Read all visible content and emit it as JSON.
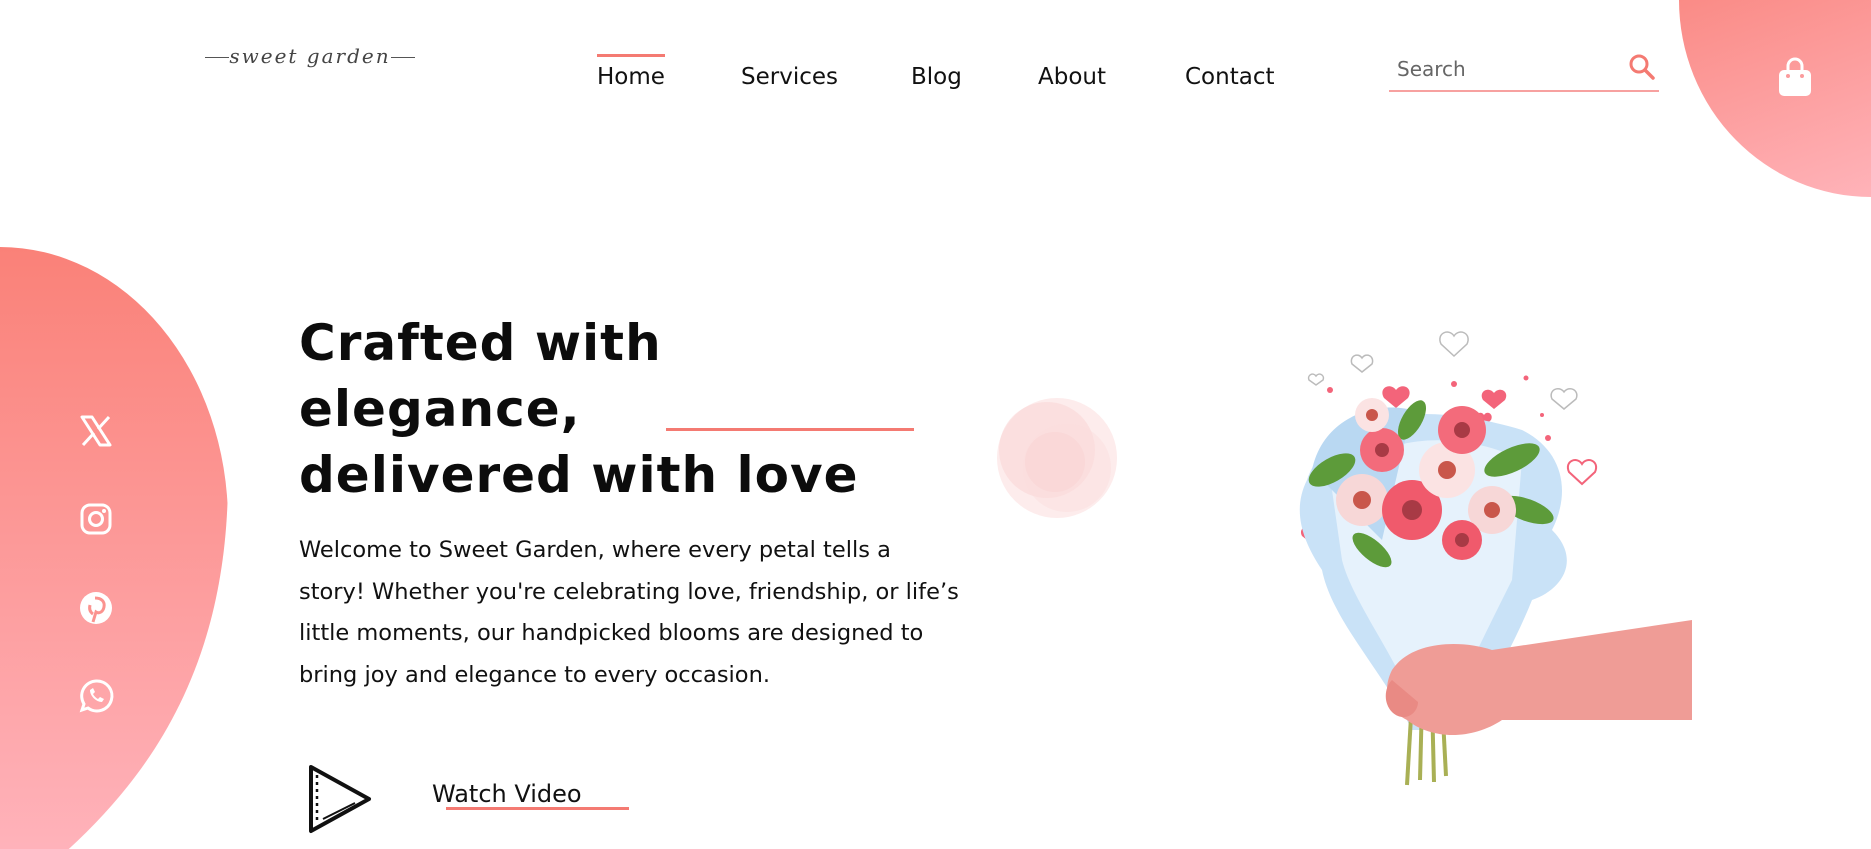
{
  "brand": {
    "logo_text": "sweet garden"
  },
  "nav": {
    "items": [
      {
        "label": "Home",
        "active": true
      },
      {
        "label": "Services",
        "active": false
      },
      {
        "label": "Blog",
        "active": false
      },
      {
        "label": "About",
        "active": false
      },
      {
        "label": "Contact",
        "active": false
      }
    ]
  },
  "search": {
    "placeholder": "Search",
    "value": ""
  },
  "icons": {
    "search": "search-icon",
    "cart": "shopping-bag-icon",
    "social": [
      "x-twitter-icon",
      "instagram-icon",
      "pinterest-icon",
      "whatsapp-icon"
    ],
    "play": "play-icon"
  },
  "hero": {
    "title_line1": "Crafted with elegance,",
    "title_line2_prefix": "delivered with ",
    "title_line2_accent": "love",
    "description": "Welcome to Sweet Garden, where every petal tells a story! Whether you're celebrating love, friendship, or life’s little moments, our handpicked blooms are designed to bring joy and elegance to every occasion.",
    "cta_label": "Watch Video"
  },
  "colors": {
    "accent": "#f47a72",
    "blob_top": "#fa8178",
    "blob_bottom": "#ffb3bb",
    "text": "#111111"
  }
}
